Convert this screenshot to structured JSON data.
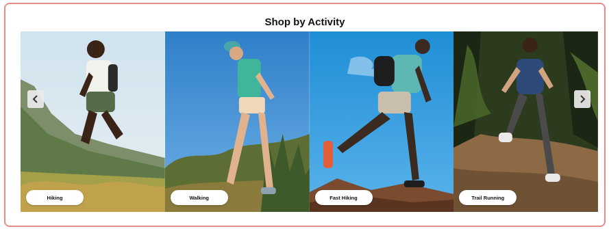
{
  "section": {
    "title": "Shop by Activity"
  },
  "activities": [
    {
      "label": "Hiking"
    },
    {
      "label": "Walking"
    },
    {
      "label": "Fast Hiking"
    },
    {
      "label": "Trail Running"
    }
  ],
  "controls": {
    "prev_icon": "chevron-left-icon",
    "next_icon": "chevron-right-icon"
  },
  "colors": {
    "border": "#e98b8b",
    "pill_bg": "#ffffff",
    "arrow_bg": "#ebebeb"
  }
}
